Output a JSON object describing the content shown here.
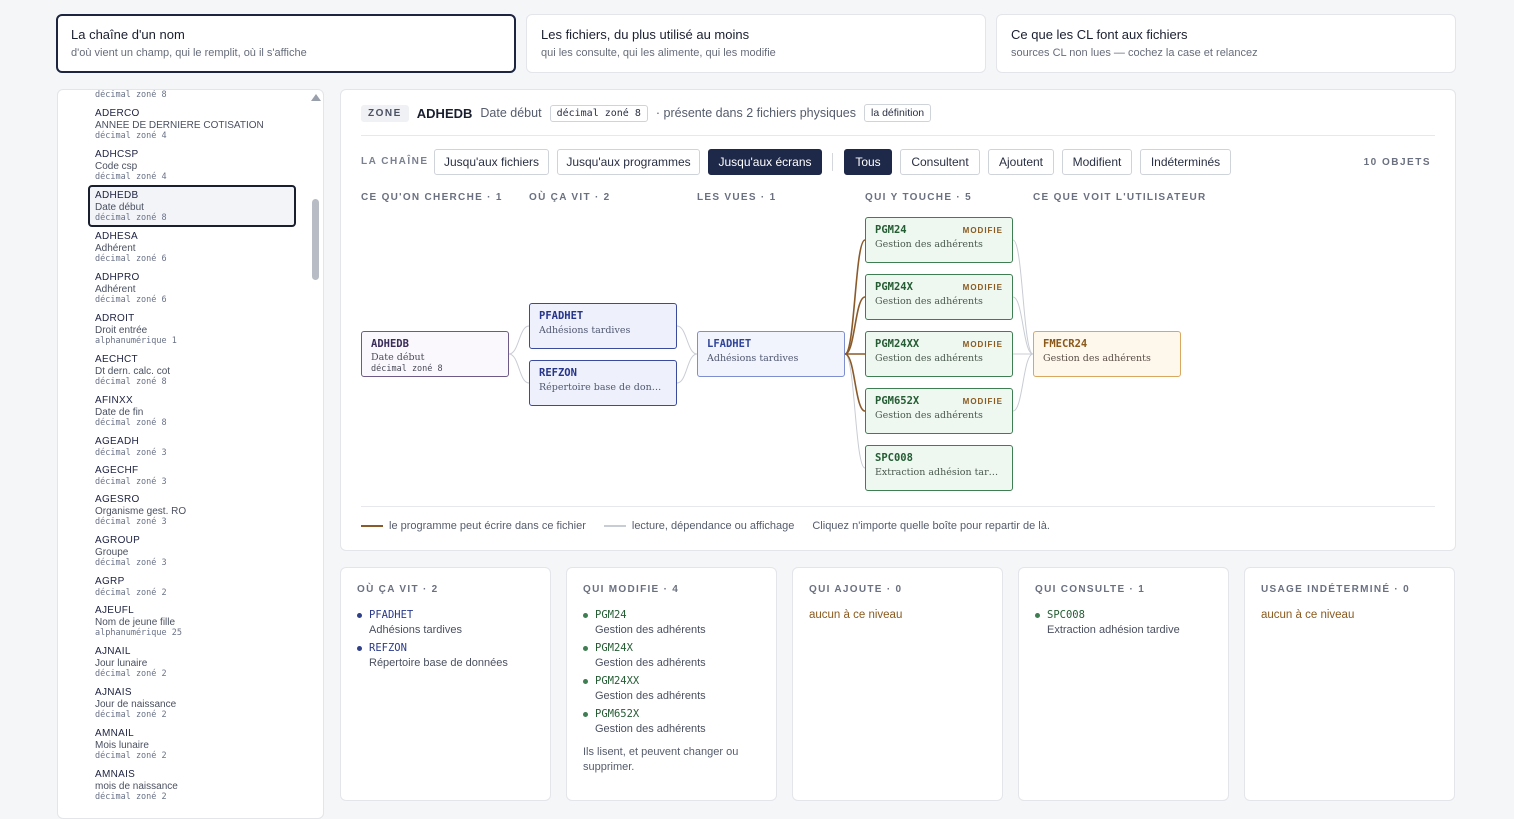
{
  "tabs": [
    {
      "title": "La chaîne d'un nom",
      "subtitle": "d'où vient un champ, qui le remplit, où il s'affiche"
    },
    {
      "title": "Les fichiers, du plus utilisé au moins",
      "subtitle": "qui les consulte, qui les alimente, qui les modifie"
    },
    {
      "title": "Ce que les CL font aux fichiers",
      "subtitle": "sources CL non lues — cochez la case et relancez"
    }
  ],
  "sidebar": {
    "top_type": "décimal zoné 8",
    "items": [
      {
        "code": "ADERCO",
        "label": "ANNEE DE DERNIERE COTISATION",
        "type": "décimal zoné 4"
      },
      {
        "code": "ADHCSP",
        "label": "Code csp",
        "type": "décimal zoné 4"
      },
      {
        "code": "ADHEDB",
        "label": "Date début",
        "type": "décimal zoné 8"
      },
      {
        "code": "ADHESA",
        "label": "Adhérent",
        "type": "décimal zoné 6"
      },
      {
        "code": "ADHPRO",
        "label": "Adhérent",
        "type": "décimal zoné 6"
      },
      {
        "code": "ADROIT",
        "label": "Droit entrée",
        "type": "alphanumérique 1"
      },
      {
        "code": "AECHCT",
        "label": "Dt dern. calc. cot",
        "type": "décimal zoné 8"
      },
      {
        "code": "AFINXX",
        "label": "Date de fin",
        "type": "décimal zoné 8"
      },
      {
        "code": "AGEADH",
        "label": "",
        "type": "décimal zoné 3"
      },
      {
        "code": "AGECHF",
        "label": "",
        "type": "décimal zoné 3"
      },
      {
        "code": "AGESRO",
        "label": "Organisme gest. RO",
        "type": "décimal zoné 3"
      },
      {
        "code": "AGROUP",
        "label": "Groupe",
        "type": "décimal zoné 3"
      },
      {
        "code": "AGRP",
        "label": "",
        "type": "décimal zoné 2"
      },
      {
        "code": "AJEUFL",
        "label": "Nom de jeune fille",
        "type": "alphanumérique 25"
      },
      {
        "code": "AJNAIL",
        "label": "Jour lunaire",
        "type": "décimal zoné 2"
      },
      {
        "code": "AJNAIS",
        "label": "Jour de naissance",
        "type": "décimal zoné 2"
      },
      {
        "code": "AMNAIL",
        "label": "Mois lunaire",
        "type": "décimal zoné 2"
      },
      {
        "code": "AMNAIS",
        "label": "mois de naissance",
        "type": "décimal zoné 2"
      }
    ]
  },
  "header": {
    "badge": "ZONE",
    "name": "ADHEDB",
    "label": "Date début",
    "type": "décimal zoné 8",
    "presence": "· présente dans 2 fichiers physiques",
    "definition_link": "la définition"
  },
  "chain": {
    "label": "LA CHAÎNE",
    "depth_buttons": [
      "Jusqu'aux fichiers",
      "Jusqu'aux programmes",
      "Jusqu'aux écrans"
    ],
    "filter_buttons": [
      "Tous",
      "Consultent",
      "Ajoutent",
      "Modifient",
      "Indéterminés"
    ],
    "count": "10 OBJETS",
    "columns": [
      "CE QU'ON CHERCHE · 1",
      "OÙ ÇA VIT · 2",
      "LES VUES · 1",
      "QUI Y TOUCHE · 5",
      "CE QUE VOIT L'UTILISATEUR"
    ]
  },
  "nodes": {
    "zone": {
      "code": "ADHEDB",
      "label": "Date début",
      "type": "décimal zoné 8"
    },
    "files": [
      {
        "code": "PFADHET",
        "label": "Adhésions tardives"
      },
      {
        "code": "REFZON",
        "label": "Répertoire base de données"
      }
    ],
    "view": {
      "code": "LFADHET",
      "label": "Adhésions tardives"
    },
    "programs": [
      {
        "code": "PGM24",
        "label": "Gestion des adhérents",
        "badge": "MODIFIE"
      },
      {
        "code": "PGM24X",
        "label": "Gestion des adhérents",
        "badge": "MODIFIE"
      },
      {
        "code": "PGM24XX",
        "label": "Gestion des adhérents",
        "badge": "MODIFIE"
      },
      {
        "code": "PGM652X",
        "label": "Gestion des adhérents",
        "badge": "MODIFIE"
      },
      {
        "code": "SPC008",
        "label": "Extraction adhésion tardi…",
        "badge": ""
      }
    ],
    "screen": {
      "code": "FMECR24",
      "label": "Gestion des adhérents"
    }
  },
  "legend": {
    "write": "le programme peut écrire dans ce fichier",
    "read": "lecture, dépendance ou affichage",
    "hint": "Cliquez n'importe quelle boîte pour repartir de là."
  },
  "colors": {
    "write": "#8a5a2a",
    "read": "#c8ccd4",
    "accent": "#1e2849"
  },
  "cards": {
    "lives": {
      "title": "OÙ ÇA VIT · 2",
      "items": [
        {
          "code": "PFADHET",
          "label": "Adhésions tardives"
        },
        {
          "code": "REFZON",
          "label": "Répertoire base de données"
        }
      ]
    },
    "modifies": {
      "title": "QUI MODIFIE · 4",
      "items": [
        {
          "code": "PGM24",
          "label": "Gestion des adhérents"
        },
        {
          "code": "PGM24X",
          "label": "Gestion des adhérents"
        },
        {
          "code": "PGM24XX",
          "label": "Gestion des adhérents"
        },
        {
          "code": "PGM652X",
          "label": "Gestion des adhérents"
        }
      ],
      "foot": "Ils lisent, et peuvent changer ou supprimer."
    },
    "adds": {
      "title": "QUI AJOUTE · 0",
      "none": "aucun à ce niveau"
    },
    "reads": {
      "title": "QUI CONSULTE · 1",
      "items": [
        {
          "code": "SPC008",
          "label": "Extraction adhésion tardive"
        }
      ]
    },
    "undetermined": {
      "title": "USAGE INDÉTERMINÉ · 0",
      "none": "aucun à ce niveau"
    }
  }
}
